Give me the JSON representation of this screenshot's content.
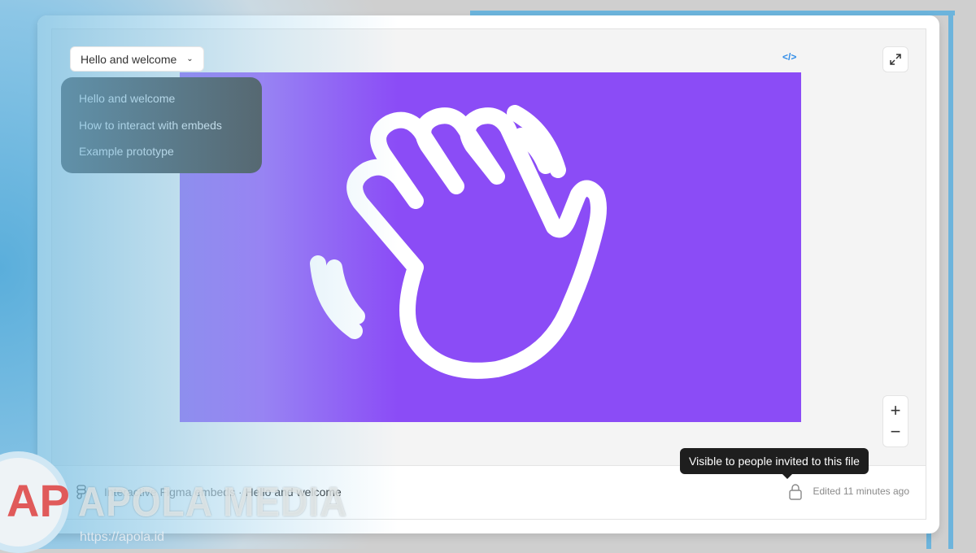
{
  "frame": {
    "selected_page": "Hello and welcome"
  },
  "menu": {
    "items": [
      "Hello and welcome",
      "How to interact with embeds",
      "Example prototype"
    ]
  },
  "toolbar": {
    "code_label": "</>",
    "expand_icon": "expand-icon",
    "zoom_in": "+",
    "zoom_out": "−"
  },
  "canvas": {
    "background": "#8b4cf6",
    "illustration": "waving-hand-icon"
  },
  "footer": {
    "file_name": "Interactive Figma embeds",
    "separator": "·",
    "page_name": "Hello and welcome",
    "edited": "Edited 11 minutes ago",
    "lock_icon": "lock-icon",
    "logo_icon": "figma-logo-icon"
  },
  "tooltip": {
    "text": "Visible to people invited to this file"
  },
  "watermark": {
    "brand": "APOLA MEDIA",
    "url": "https://apola.id",
    "logo": "AP"
  }
}
